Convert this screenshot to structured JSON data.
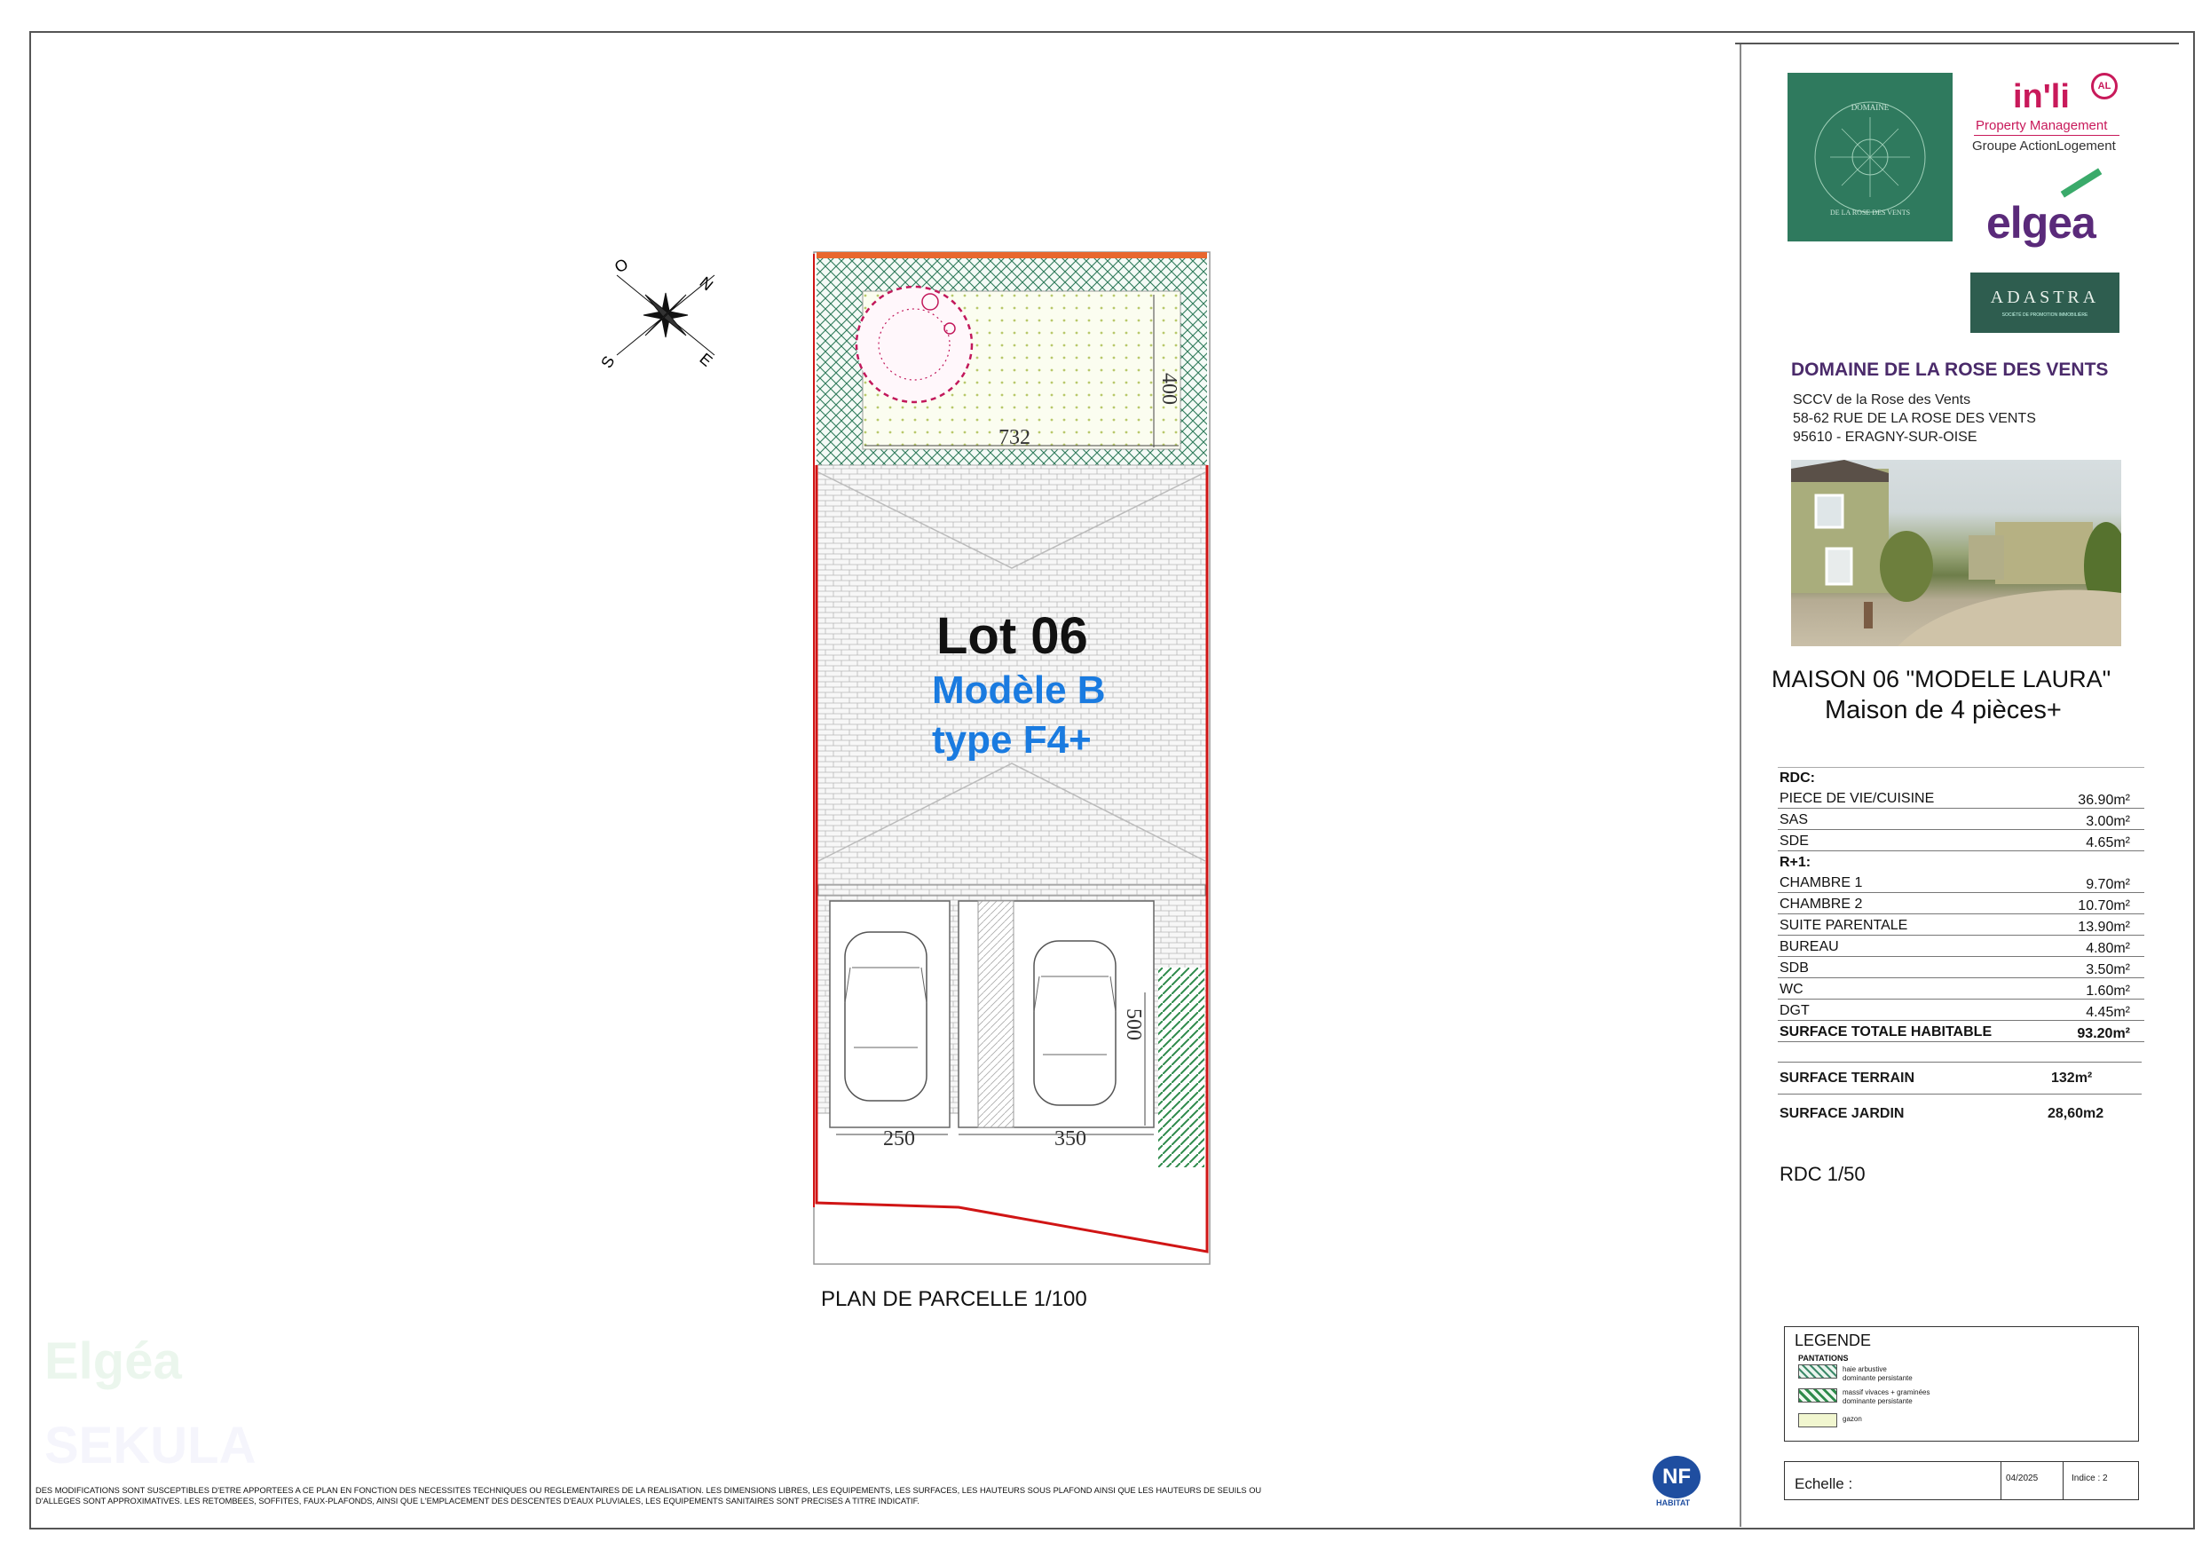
{
  "plan": {
    "lot_title": "Lot 06",
    "model_line1": "Modèle B",
    "model_line2": "type F4+",
    "caption": "PLAN DE PARCELLE 1/100",
    "dims": {
      "garden_width": "732",
      "garden_depth": "400",
      "parking_left": "250",
      "parking_right": "350",
      "parking_depth": "500"
    }
  },
  "compass": {
    "n": "N",
    "e": "E",
    "s": "S",
    "o": "O"
  },
  "logos": {
    "rose_ring_top": "DOMAINE",
    "rose_ring_bottom": "DE LA ROSE DES VENTS",
    "inli": "in'li",
    "inli_badge": "AL",
    "inli_pm": "Property Management",
    "inli_group": "Groupe ActionLogement",
    "elgea": "elgea",
    "adastra": "ADASTRA",
    "adastra_sub": "SOCIÉTÉ DE PROMOTION IMMOBILIÈRE"
  },
  "project": {
    "title": "DOMAINE DE LA ROSE DES VENTS",
    "addr1": "SCCV de la Rose des Vents",
    "addr2": "58-62 RUE DE LA ROSE DES VENTS",
    "addr3": "95610 - ERAGNY-SUR-OISE"
  },
  "house": {
    "name": "MAISON 06 \"MODELE LAURA\"",
    "subtitle": "Maison de 4 pièces+"
  },
  "surfaces": {
    "rdc_label": "RDC:",
    "rdc": [
      {
        "name": "PIECE DE VIE/CUISINE",
        "value": "36.90m²"
      },
      {
        "name": "SAS",
        "value": "3.00m²"
      },
      {
        "name": "SDE",
        "value": "4.65m²"
      }
    ],
    "r1_label": "R+1:",
    "r1": [
      {
        "name": "CHAMBRE 1",
        "value": "9.70m²"
      },
      {
        "name": "CHAMBRE 2",
        "value": "10.70m²"
      },
      {
        "name": "SUITE PARENTALE",
        "value": "13.90m²"
      },
      {
        "name": "BUREAU",
        "value": "4.80m²"
      },
      {
        "name": "SDB",
        "value": "3.50m²"
      },
      {
        "name": "WC",
        "value": "1.60m²"
      },
      {
        "name": "DGT",
        "value": "4.45m²"
      }
    ],
    "total_name": "SURFACE TOTALE HABITABLE",
    "total_value": "93.20m²",
    "terrain_name": "SURFACE TERRAIN",
    "terrain_value": "132m²",
    "jardin_name": "SURFACE JARDIN",
    "jardin_value": "28,60m2",
    "scale": "RDC 1/50"
  },
  "legend": {
    "title": "LEGENDE",
    "section": "PANTATIONS",
    "item1_l1": "haie arbustive",
    "item1_l2": "dominante persistante",
    "item2_l1": "massif vivaces + graminées",
    "item2_l2": "dominante persistante",
    "item3": "gazon"
  },
  "footer": {
    "echelle": "Echelle :",
    "date": "04/2025",
    "indice": "Indice : 2",
    "disclaimer": "DES MODIFICATIONS SONT SUSCEPTIBLES D'ETRE APPORTEES A CE PLAN EN FONCTION DES NECESSITES TECHNIQUES OU REGLEMENTAIRES DE LA REALISATION. LES DIMENSIONS LIBRES, LES EQUIPEMENTS, LES SURFACES, LES HAUTEURS SOUS PLAFOND AINSI QUE LES HAUTEURS DE SEUILS OU D'ALLEGES SONT APPROXIMATIVES. LES RETOMBEES, SOFFITES, FAUX-PLAFONDS, AINSI QUE L'EMPLACEMENT DES DESCENTES D'EAUX PLUVIALES, LES EQUIPEMENTS SANITAIRES SONT PRECISES A TITRE INDICATIF.",
    "nf": "NF",
    "nf_sub": "HABITAT",
    "watermark1": "Elgéa",
    "watermark2": "SEKULA"
  }
}
